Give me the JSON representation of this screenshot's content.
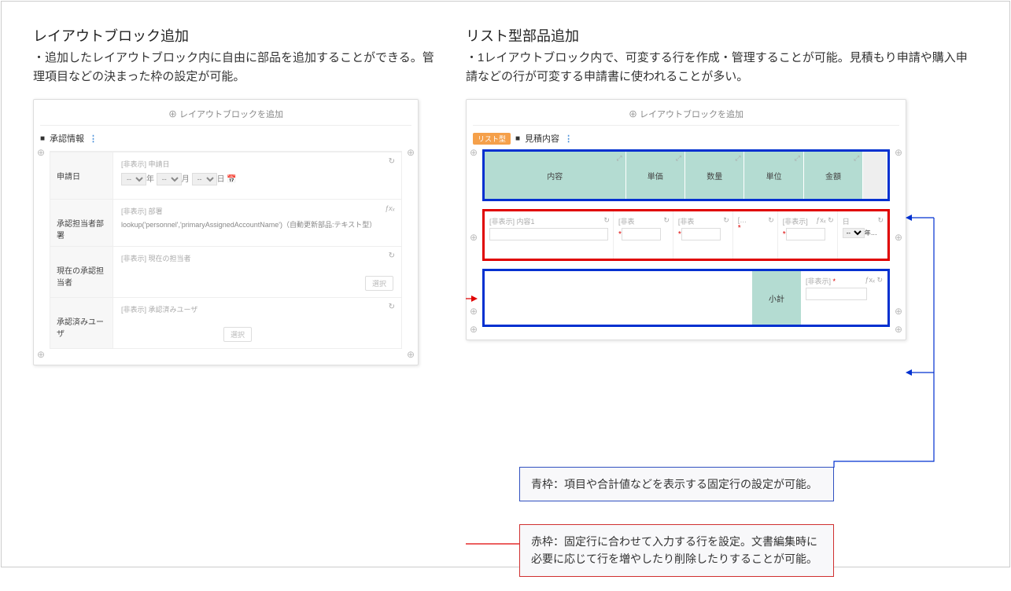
{
  "left": {
    "title": "レイアウトブロック追加",
    "desc": "・追加したレイアウトブロック内に自由に部品を追加することができる。管理項目などの決まった枠の設定が可能。",
    "panel": {
      "add_block": "⊕ レイアウトブロックを追加",
      "block_title": "承認情報",
      "rows": [
        {
          "label": "申請日",
          "hidden": "[非表示] 申請日",
          "date_parts": [
            "年",
            "月",
            "日"
          ]
        },
        {
          "label": "承認担当者部署",
          "hidden": "[非表示] 部署",
          "lookup": "lookup('personnel','primaryAssignedAccountName')（自動更新部品:テキスト型）"
        },
        {
          "label": "現在の承認担当者",
          "hidden": "[非表示] 現在の担当者",
          "btn": "選択"
        },
        {
          "label": "承認済みユーザ",
          "hidden": "[非表示] 承認済みユーザ",
          "btn": "選択"
        }
      ]
    }
  },
  "right": {
    "title": "リスト型部品追加",
    "desc": "・1レイアウトブロック内で、可変する行を作成・管理することが可能。見積もり申請や購入申請などの行が可変する申請書に使われることが多い。",
    "panel": {
      "add_block": "⊕ レイアウトブロックを追加",
      "badge": "リスト型",
      "block_title": "見積内容",
      "header_cells": [
        "内容",
        "単価",
        "数量",
        "単位",
        "金額"
      ],
      "input_cells": [
        {
          "lbl": "[非表示] 内容1",
          "req": false
        },
        {
          "lbl": "[非表",
          "req": true
        },
        {
          "lbl": "[非表",
          "req": true
        },
        {
          "lbl": "[…",
          "req": true
        },
        {
          "lbl": "[非表示]",
          "req": true,
          "fx": true
        },
        {
          "lbl": "日",
          "req": false
        }
      ],
      "subtotal": {
        "label": "小計",
        "hidden": "[非表示]",
        "fx": "ƒxₓ ↻"
      }
    },
    "callouts": {
      "blue": "青枠：項目や合計値などを表示する固定行の設定が可能。",
      "red": "赤枠：固定行に合わせて入力する行を設定。文書編集時に必要に応じて行を増やしたり削除したりすることが可能。"
    }
  }
}
